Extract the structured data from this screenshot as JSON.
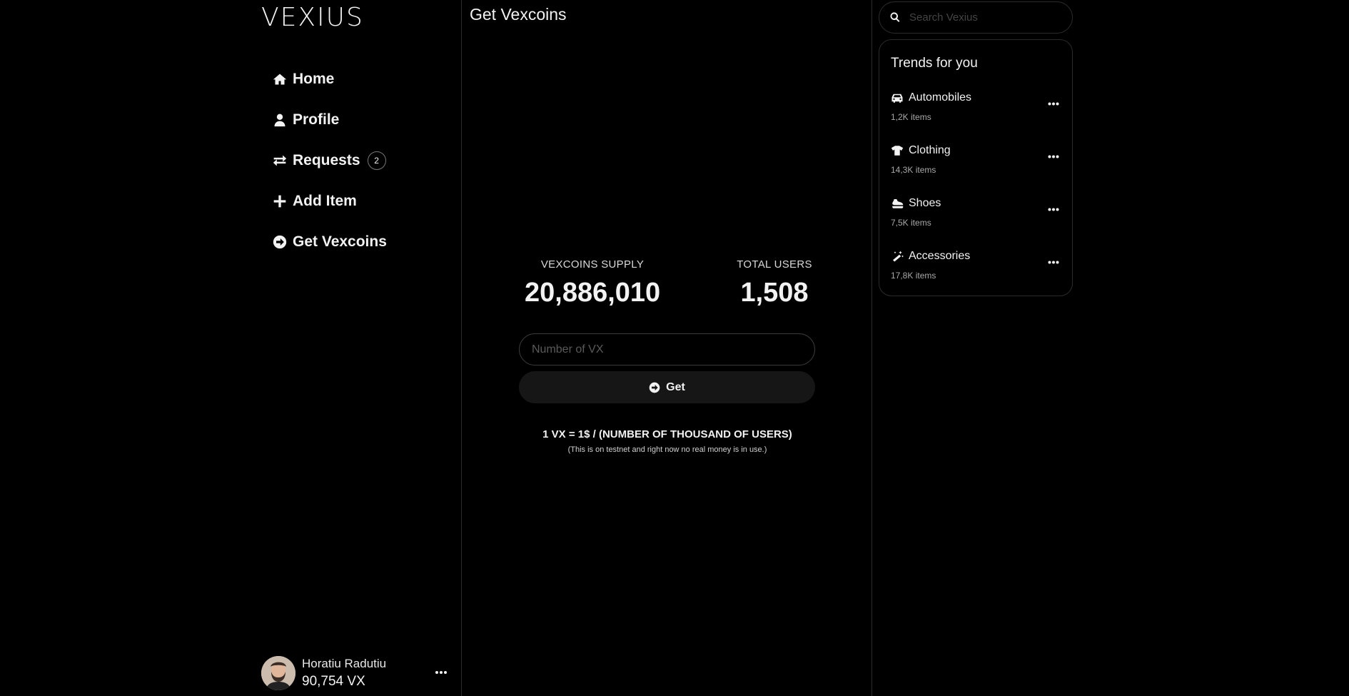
{
  "brand": {
    "logo_text": "VEXIUS"
  },
  "nav": {
    "items": [
      {
        "label": "Home",
        "icon": "home-icon"
      },
      {
        "label": "Profile",
        "icon": "user-icon"
      },
      {
        "label": "Requests",
        "icon": "exchange-icon",
        "badge": "2"
      },
      {
        "label": "Add Item",
        "icon": "plus-icon"
      },
      {
        "label": "Get Vexcoins",
        "icon": "circle-arrow-right-icon"
      }
    ]
  },
  "user": {
    "name": "Horatiu Radutiu",
    "balance": "90,754 VX",
    "more_icon": "ellipsis-icon"
  },
  "main": {
    "title": "Get Vexcoins",
    "stats": {
      "supply_label": "VEXCOINS SUPPLY",
      "supply_value": "20,886,010",
      "users_label": "TOTAL USERS",
      "users_value": "1,508"
    },
    "input": {
      "placeholder": "Number of VX",
      "value": ""
    },
    "get_button": {
      "label": "Get",
      "icon": "circle-arrow-right-icon"
    },
    "formula": "1 VX = 1$ / (NUMBER OF THOUSAND OF USERS)",
    "disclaimer": "(This is on testnet and right now no real money is in use.)"
  },
  "search": {
    "placeholder": "Search Vexius",
    "value": "",
    "icon": "search-icon"
  },
  "trends": {
    "title": "Trends for you",
    "items": [
      {
        "label": "Automobiles",
        "count": "1,2K items",
        "icon": "car-icon"
      },
      {
        "label": "Clothing",
        "count": "14,3K items",
        "icon": "tshirt-icon"
      },
      {
        "label": "Shoes",
        "count": "7,5K items",
        "icon": "shoe-icon"
      },
      {
        "label": "Accessories",
        "count": "17,8K items",
        "icon": "magic-wand-icon"
      }
    ]
  },
  "colors": {
    "background": "#000000",
    "text": "#f2f2f2",
    "border": "#2a2a2a",
    "button_bg": "#161616",
    "muted_text": "#a8a8a8"
  }
}
